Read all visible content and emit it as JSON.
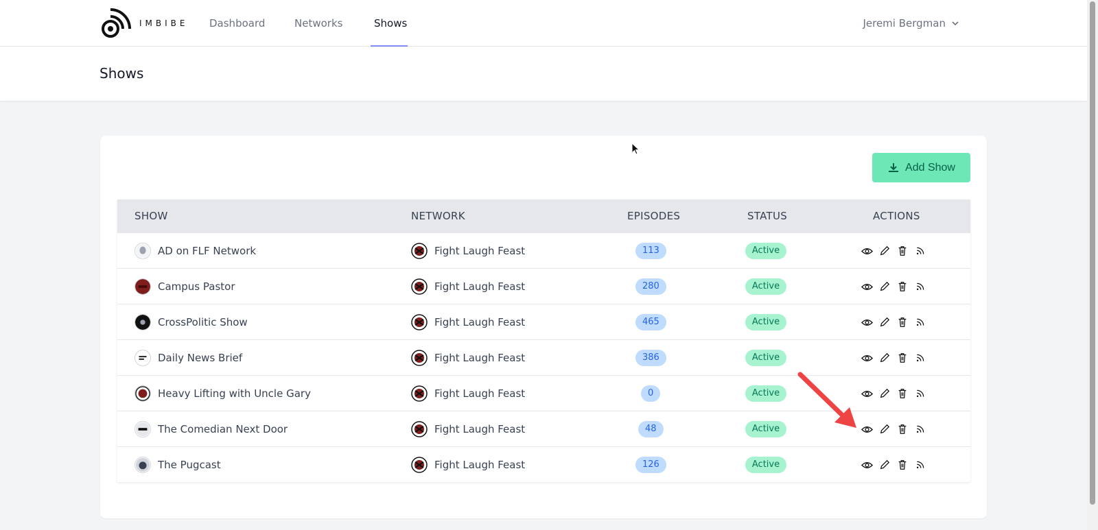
{
  "brand": {
    "logo_text": "IMBIBE"
  },
  "nav": {
    "links": [
      {
        "label": "Dashboard"
      },
      {
        "label": "Networks"
      },
      {
        "label": "Shows"
      }
    ],
    "user_name": "Jeremi Bergman"
  },
  "page": {
    "title": "Shows"
  },
  "toolbar": {
    "add_label": "Add Show"
  },
  "table": {
    "headers": [
      "SHOW",
      "NETWORK",
      "EPISODES",
      "STATUS",
      "ACTIONS"
    ],
    "rows": [
      {
        "show": "AD on FLF Network",
        "network": "Fight Laugh Feast",
        "episodes": "113",
        "status": "Active"
      },
      {
        "show": "Campus Pastor",
        "network": "Fight Laugh Feast",
        "episodes": "280",
        "status": "Active"
      },
      {
        "show": "CrossPolitic Show",
        "network": "Fight Laugh Feast",
        "episodes": "465",
        "status": "Active"
      },
      {
        "show": "Daily News Brief",
        "network": "Fight Laugh Feast",
        "episodes": "386",
        "status": "Active"
      },
      {
        "show": "Heavy Lifting with Uncle Gary",
        "network": "Fight Laugh Feast",
        "episodes": "0",
        "status": "Active"
      },
      {
        "show": "The Comedian Next Door",
        "network": "Fight Laugh Feast",
        "episodes": "48",
        "status": "Active"
      },
      {
        "show": "The Pugcast",
        "network": "Fight Laugh Feast",
        "episodes": "126",
        "status": "Active"
      }
    ]
  },
  "colors": {
    "accent_underline": "#818cf8",
    "add_button": "#6ee7b7",
    "episodes_badge": "#bfdbfe",
    "status_badge": "#a7f3d0",
    "annotation_arrow": "#ef4444"
  },
  "icons": {
    "row_actions": [
      "eye-icon",
      "pencil-icon",
      "trash-icon",
      "rss-icon"
    ],
    "add_button": "download-icon",
    "user_menu": "chevron-down-icon"
  }
}
